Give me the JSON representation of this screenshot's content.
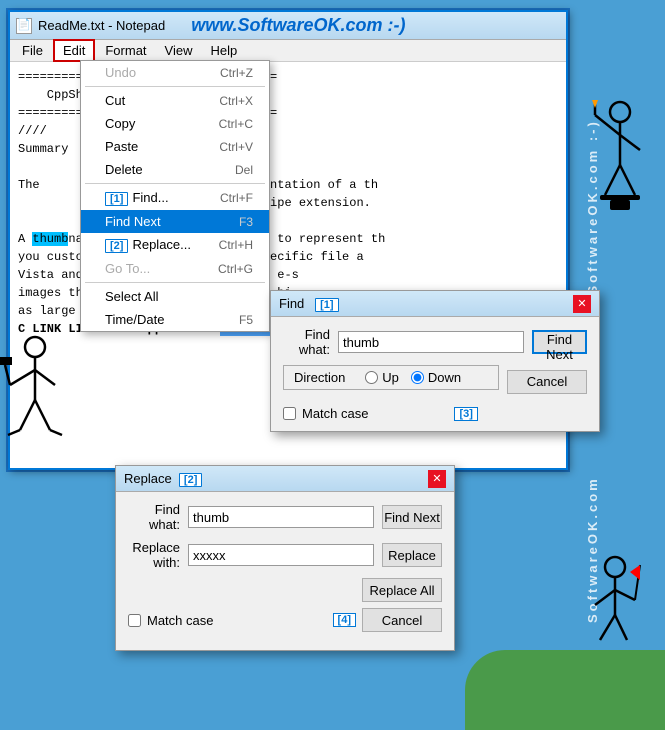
{
  "app": {
    "title": "ReadMe.txt - Notepad",
    "website": "www.SoftwareOK.com :-)"
  },
  "menubar": {
    "items": [
      "File",
      "Edit",
      "Format",
      "View",
      "Help"
    ]
  },
  "edit_menu": {
    "items": [
      {
        "label": "Undo",
        "shortcut": "Ctrl+Z",
        "disabled": true
      },
      {
        "separator": true
      },
      {
        "label": "Cut",
        "shortcut": "Ctrl+X"
      },
      {
        "label": "Copy",
        "shortcut": "Ctrl+C"
      },
      {
        "label": "Paste",
        "shortcut": "Ctrl+V"
      },
      {
        "label": "Delete",
        "shortcut": "Del"
      },
      {
        "separator": true
      },
      {
        "label": "Find...",
        "shortcut": "Ctrl+F",
        "badge": "[1]"
      },
      {
        "label": "Find Next",
        "shortcut": "F3",
        "highlighted": true
      },
      {
        "label": "Replace...",
        "shortcut": "Ctrl+H",
        "badge": "[2]"
      },
      {
        "label": "Go To...",
        "shortcut": "Ctrl+G",
        "disabled": true
      },
      {
        "separator": true
      },
      {
        "label": "Select All",
        "shortcut": "Ctrl+A"
      },
      {
        "label": "Time/Date",
        "shortcut": "F5"
      }
    ]
  },
  "notepad_content": {
    "lines": [
      "====================================",
      "    CppShellExtThumbnailHandler Pro",
      "====================================",
      "////",
      "Summary",
      "",
      "The [1]         es the C++ implementation of a th",
      "              ered with the .recipe extension.",
      "",
      "A th          provides an image to represent th",
      "you           of files with a specific file",
      "Vist          thu",
      "ima           e-s",
      "as            bi",
      "C LINK LIBRARY : CppShellExtThumbnailHandler Project Overview",
      "",
      "/////"
    ]
  },
  "find_dialog": {
    "title": "Find",
    "badge": "[1]",
    "find_what_label": "Find what:",
    "find_what_value": "thumb",
    "find_next_btn": "Find Next",
    "cancel_btn": "Cancel",
    "direction_label": "Direction",
    "up_label": "Up",
    "down_label": "Down",
    "match_case_label": "Match case",
    "badge3": "[3]"
  },
  "replace_dialog": {
    "title": "Replace",
    "badge": "[2]",
    "find_what_label": "Find what:",
    "find_what_value": "thumb",
    "replace_with_label": "Replace with:",
    "replace_with_value": "xxxxx",
    "find_next_btn": "Find Next",
    "replace_btn": "Replace",
    "replace_all_btn": "Replace All",
    "cancel_btn": "Cancel",
    "match_case_label": "Match case",
    "badge4": "[4]"
  }
}
